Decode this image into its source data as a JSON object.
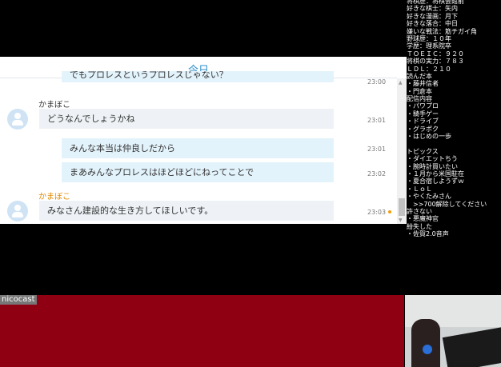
{
  "chat": {
    "date_label": "今日",
    "partial_message": "でもプロレスというプロレスじゃない？",
    "partial_time": "23:00",
    "messages": [
      {
        "sender": "かまぼこ",
        "text": "どうなんでしょうかね",
        "time": "23:01"
      },
      {
        "text": "みんな本当は仲良しだから",
        "time": "23:01"
      },
      {
        "text": "まあみんなプロレスはほどほどにねってことで",
        "time": "23:02"
      },
      {
        "sender": "かまぼこ",
        "text": "みなさん建設的な生き方してほしいです。",
        "time": "23:03"
      }
    ]
  },
  "overlay_lines": [
    "将棋歴：将棋会館前",
    "好きな棋士：矢内",
    "好きな漫画：月下",
    "好きな落合：中日",
    "嫌いな戦法：筋チガイ角",
    "野球歴：１０年",
    "学歴：理系院卒",
    "ＴＯＥＩＣ：９２０",
    "将棋の実力：７８３",
    "ＬＤＬ：２１０",
    "読んだ本",
    "・藤井信者",
    "・門倉本",
    "配信内容",
    "・パワプロ",
    "・騎手ゲー",
    "・ドライブ",
    "・グラポク",
    "・はじめの一歩",
    "",
    "トピックス",
    "・ダイエットちう",
    "・腕時計買いたい",
    "・１月から米国駐在",
    "・夏合宿しようずｗ",
    "・ＬｏＬ",
    "・やくたみさん",
    "　>>700解除してください",
    "許さない",
    "・悪魔神官",
    "紛失した",
    "・佐賀2.0音声"
  ],
  "banner": {
    "label": "nicocast",
    "color": "#8f0012"
  }
}
